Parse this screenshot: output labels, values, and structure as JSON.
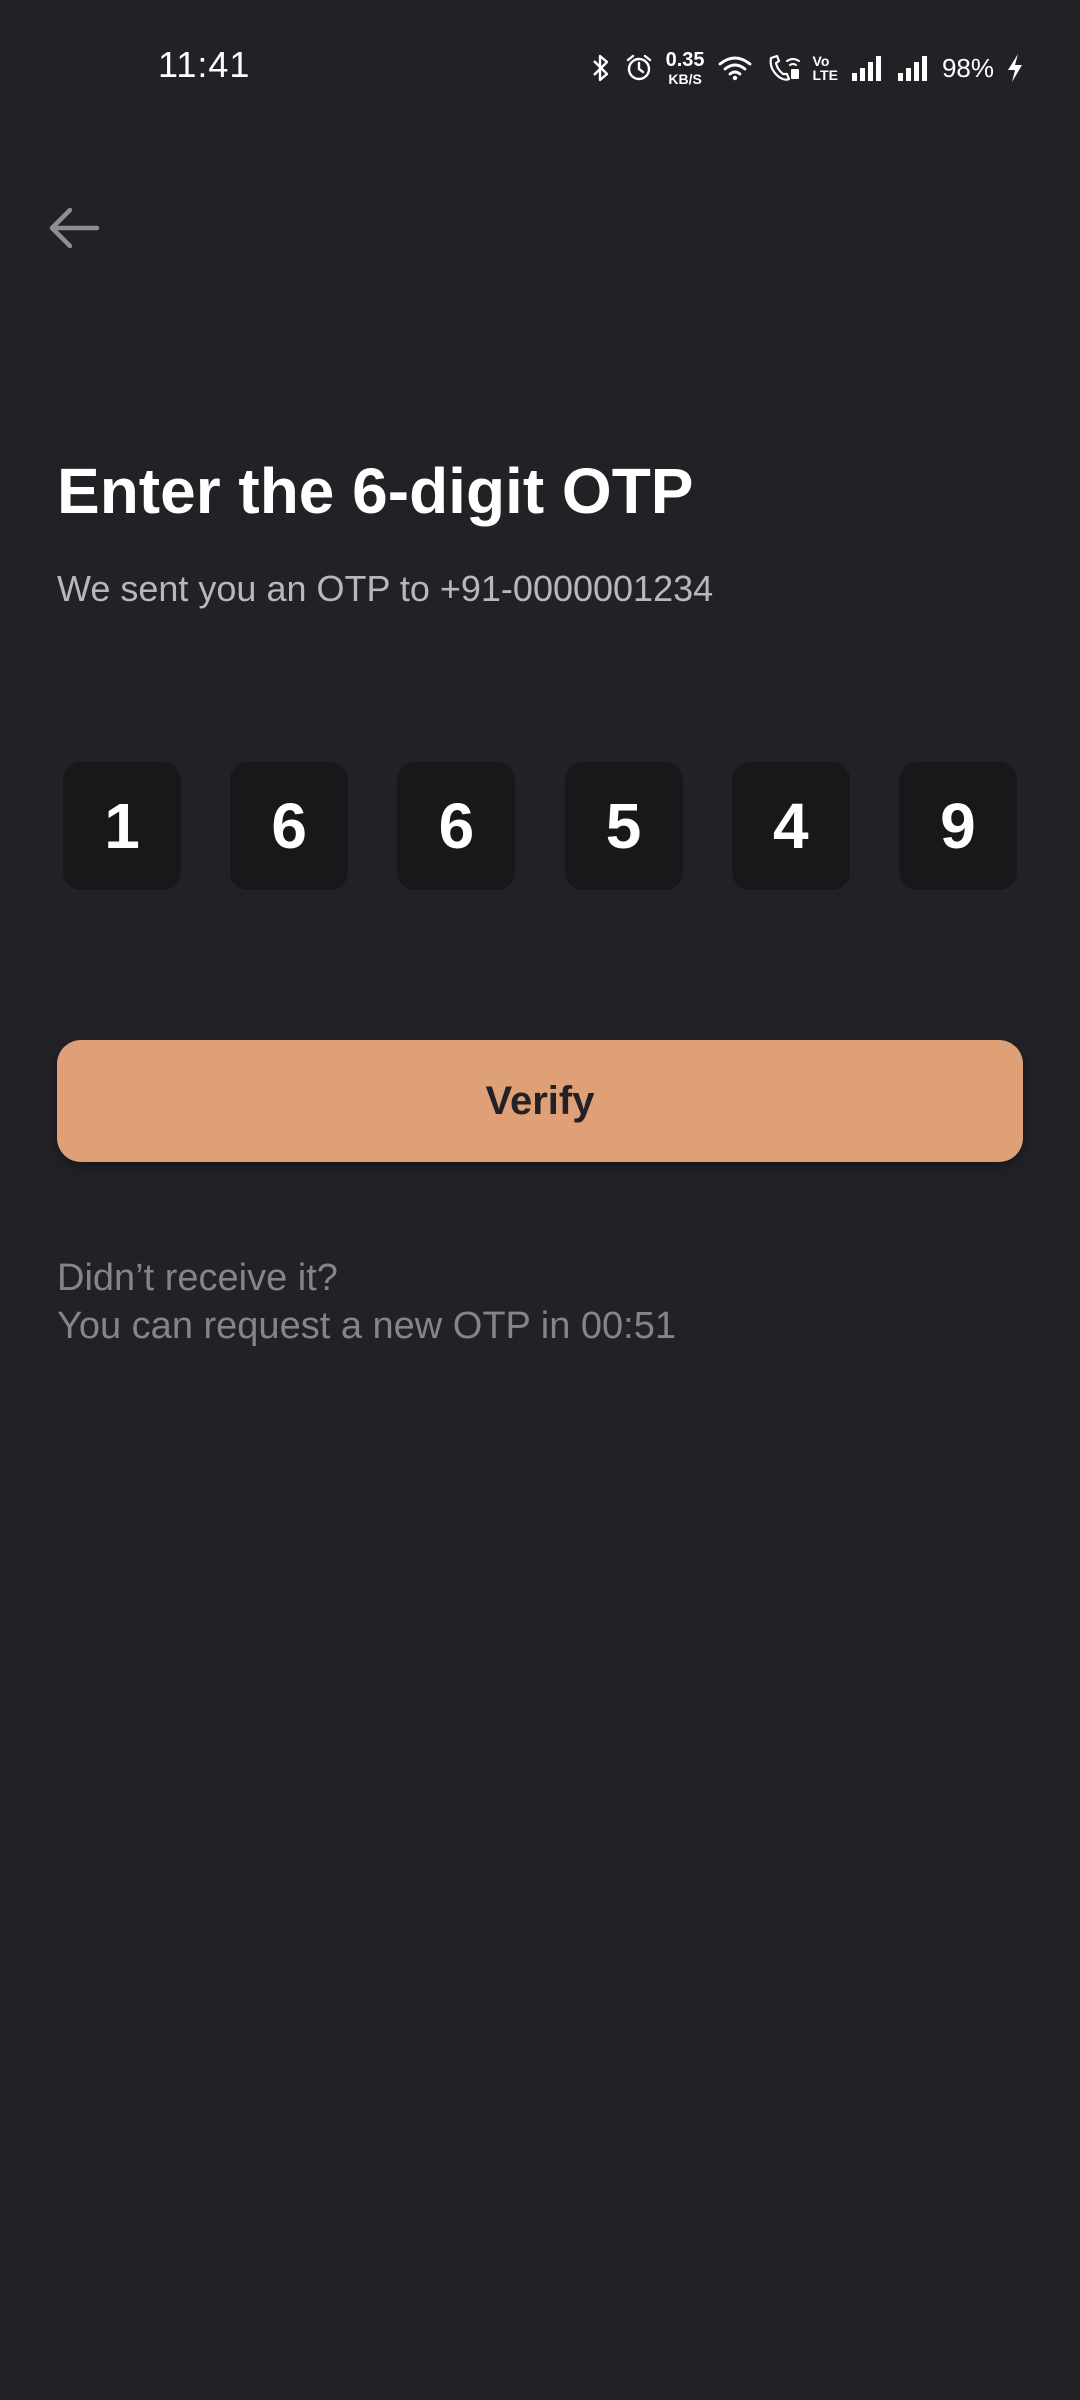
{
  "status_bar": {
    "time": "11:41",
    "speed_value": "0.35",
    "speed_unit": "KB/S",
    "volte_top": "Vo",
    "volte_bottom": "LTE",
    "battery": "98%"
  },
  "header": {
    "back_icon": "arrow-left-icon"
  },
  "main": {
    "title": "Enter the 6-digit OTP",
    "subtitle": "We sent you an OTP to +91-0000001234",
    "otp_digits": [
      "1",
      "6",
      "6",
      "5",
      "4",
      "9"
    ],
    "verify_label": "Verify",
    "resend_line1": "Didn’t receive it?",
    "resend_line2": "You can request a new OTP in 00:51"
  },
  "colors": {
    "background": "#222126",
    "otp_box": "#18181a",
    "accent": "#e0a077",
    "muted_text": "#85848a",
    "subtitle_text": "#b8b7bc"
  }
}
